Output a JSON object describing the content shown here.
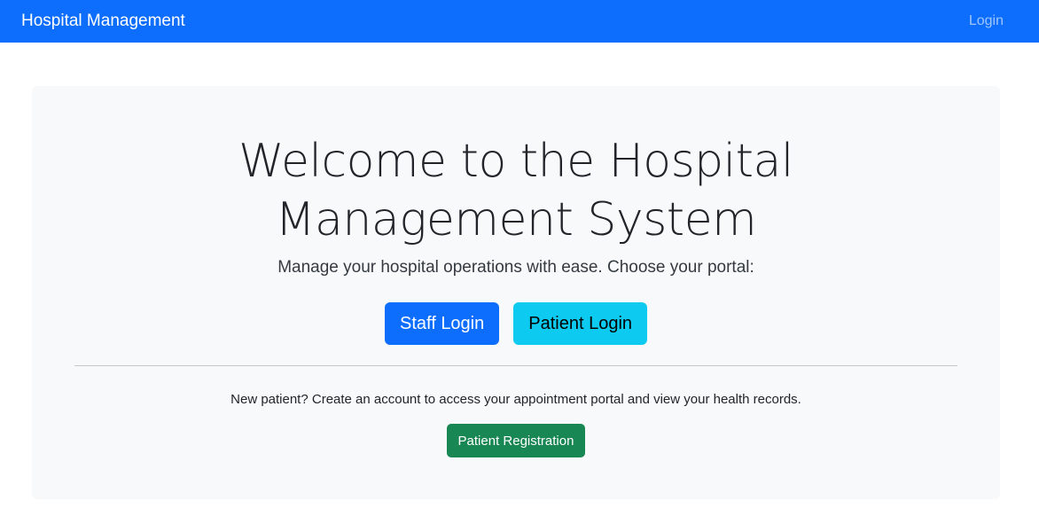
{
  "navbar": {
    "brand": "Hospital Management",
    "login_link": "Login",
    "bg_color": "#0d6efd"
  },
  "hero": {
    "title": "Welcome to the Hospital Management System",
    "subtitle": "Manage your hospital operations with ease. Choose your portal:",
    "staff_login_label": "Staff Login",
    "patient_login_label": "Patient Login",
    "new_patient_text": "New patient? Create an account to access your appointment portal and view your health records.",
    "registration_label": "Patient Registration"
  },
  "colors": {
    "primary": "#0d6efd",
    "info": "#0dcaf0",
    "success": "#198754",
    "panel_bg": "#f8f9fa"
  }
}
